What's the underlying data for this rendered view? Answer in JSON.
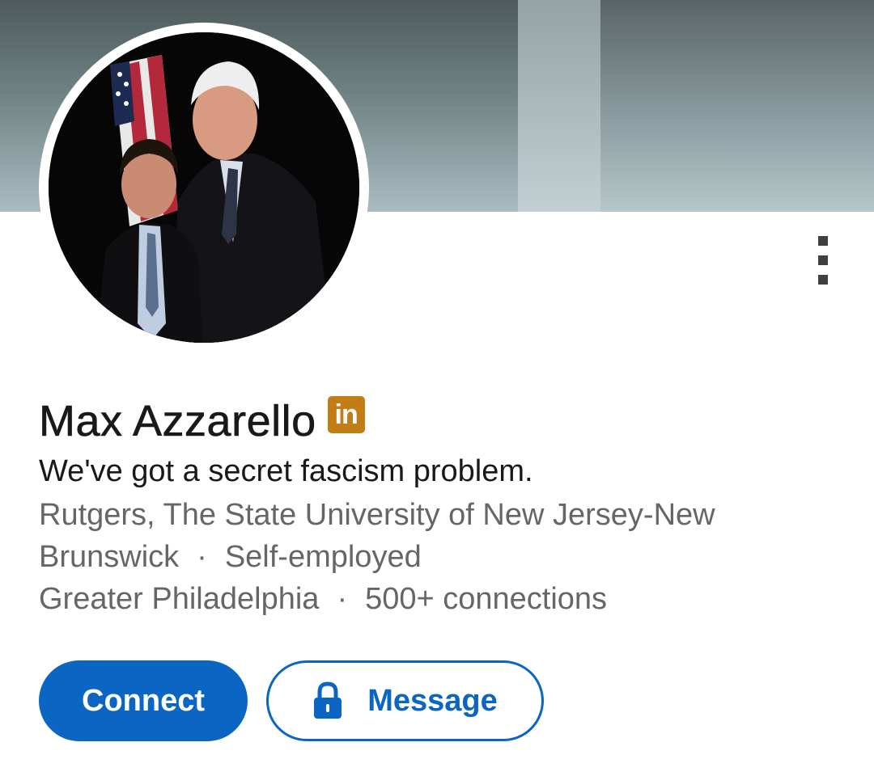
{
  "profile": {
    "name": "Max Azzarello",
    "badge_label": "in",
    "headline": "We've got a secret fascism problem.",
    "education_line1": "Rutgers, The State University of New Jersey-New",
    "education_line2": "Brunswick",
    "separator": "·",
    "employment": "Self-employed",
    "location": "Greater Philadelphia",
    "connections": "500+ connections"
  },
  "actions": {
    "connect_label": "Connect",
    "message_label": "Message"
  },
  "icons": {
    "overflow": "more-vertical-icon",
    "lock": "lock-icon",
    "badge": "linkedin-icon"
  },
  "colors": {
    "primary": "#0a66c2",
    "badge": "#c37d16",
    "text_primary": "#191919",
    "text_secondary": "#666666"
  }
}
